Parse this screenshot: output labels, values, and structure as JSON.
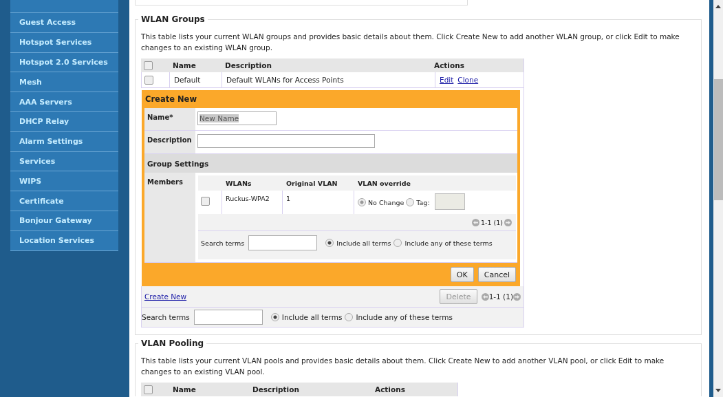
{
  "sidebar": {
    "items": [
      {
        "label": "Guest Access"
      },
      {
        "label": "Hotspot Services"
      },
      {
        "label": "Hotspot 2.0 Services"
      },
      {
        "label": "Mesh"
      },
      {
        "label": "AAA Servers"
      },
      {
        "label": "DHCP Relay"
      },
      {
        "label": "Alarm Settings"
      },
      {
        "label": "Services"
      },
      {
        "label": "WIPS"
      },
      {
        "label": "Certificate"
      },
      {
        "label": "Bonjour Gateway"
      },
      {
        "label": "Location Services"
      }
    ]
  },
  "wlan_groups": {
    "title": "WLAN Groups",
    "description": "This table lists your current WLAN groups and provides basic details about them. Click Create New to add another WLAN group, or click Edit to make changes to an existing WLAN group.",
    "table": {
      "header_checked": false,
      "columns": [
        "Name",
        "Description",
        "Actions"
      ],
      "rows": [
        {
          "checked": false,
          "name": "Default",
          "description": "Default WLANs for Access Points",
          "actions": [
            "Edit",
            "Clone"
          ]
        }
      ]
    },
    "create_form": {
      "title": "Create New",
      "name_label": "Name*",
      "name_value": "New Name",
      "description_label": "Description",
      "group_settings": "Group Settings",
      "members_label": "Members",
      "members_table": {
        "columns": [
          "WLANs",
          "Original VLAN",
          "VLAN override"
        ],
        "rows": [
          {
            "checked": false,
            "wlan": "Ruckus-WPA2",
            "original_vlan": "1",
            "override_options": [
              {
                "label": "No Change",
                "selected": true
              },
              {
                "label": "Tag:",
                "selected": false
              }
            ]
          }
        ],
        "pager": "1-1 (1)"
      },
      "search": {
        "label": "Search terms",
        "options": [
          {
            "label": "Include all terms",
            "selected": true
          },
          {
            "label": "Include any of these terms",
            "selected": false
          }
        ]
      },
      "buttons": [
        "OK",
        "Cancel"
      ]
    },
    "create_new_link": "Create New",
    "delete_button": {
      "label": "Delete",
      "disabled": true
    },
    "pager": "1-1 (1)",
    "search": {
      "label": "Search terms",
      "options": [
        {
          "label": "Include all terms",
          "selected": true
        },
        {
          "label": "Include any of these terms",
          "selected": false
        }
      ]
    }
  },
  "vlan_pooling": {
    "title": "VLAN Pooling",
    "description": "This table lists your current VLAN pools and provides basic details about them. Click Create New to add another VLAN pool, or click Edit to make changes to an existing VLAN pool.",
    "table": {
      "header_checked": false,
      "columns": [
        "Name",
        "Description",
        "Actions"
      ]
    }
  }
}
